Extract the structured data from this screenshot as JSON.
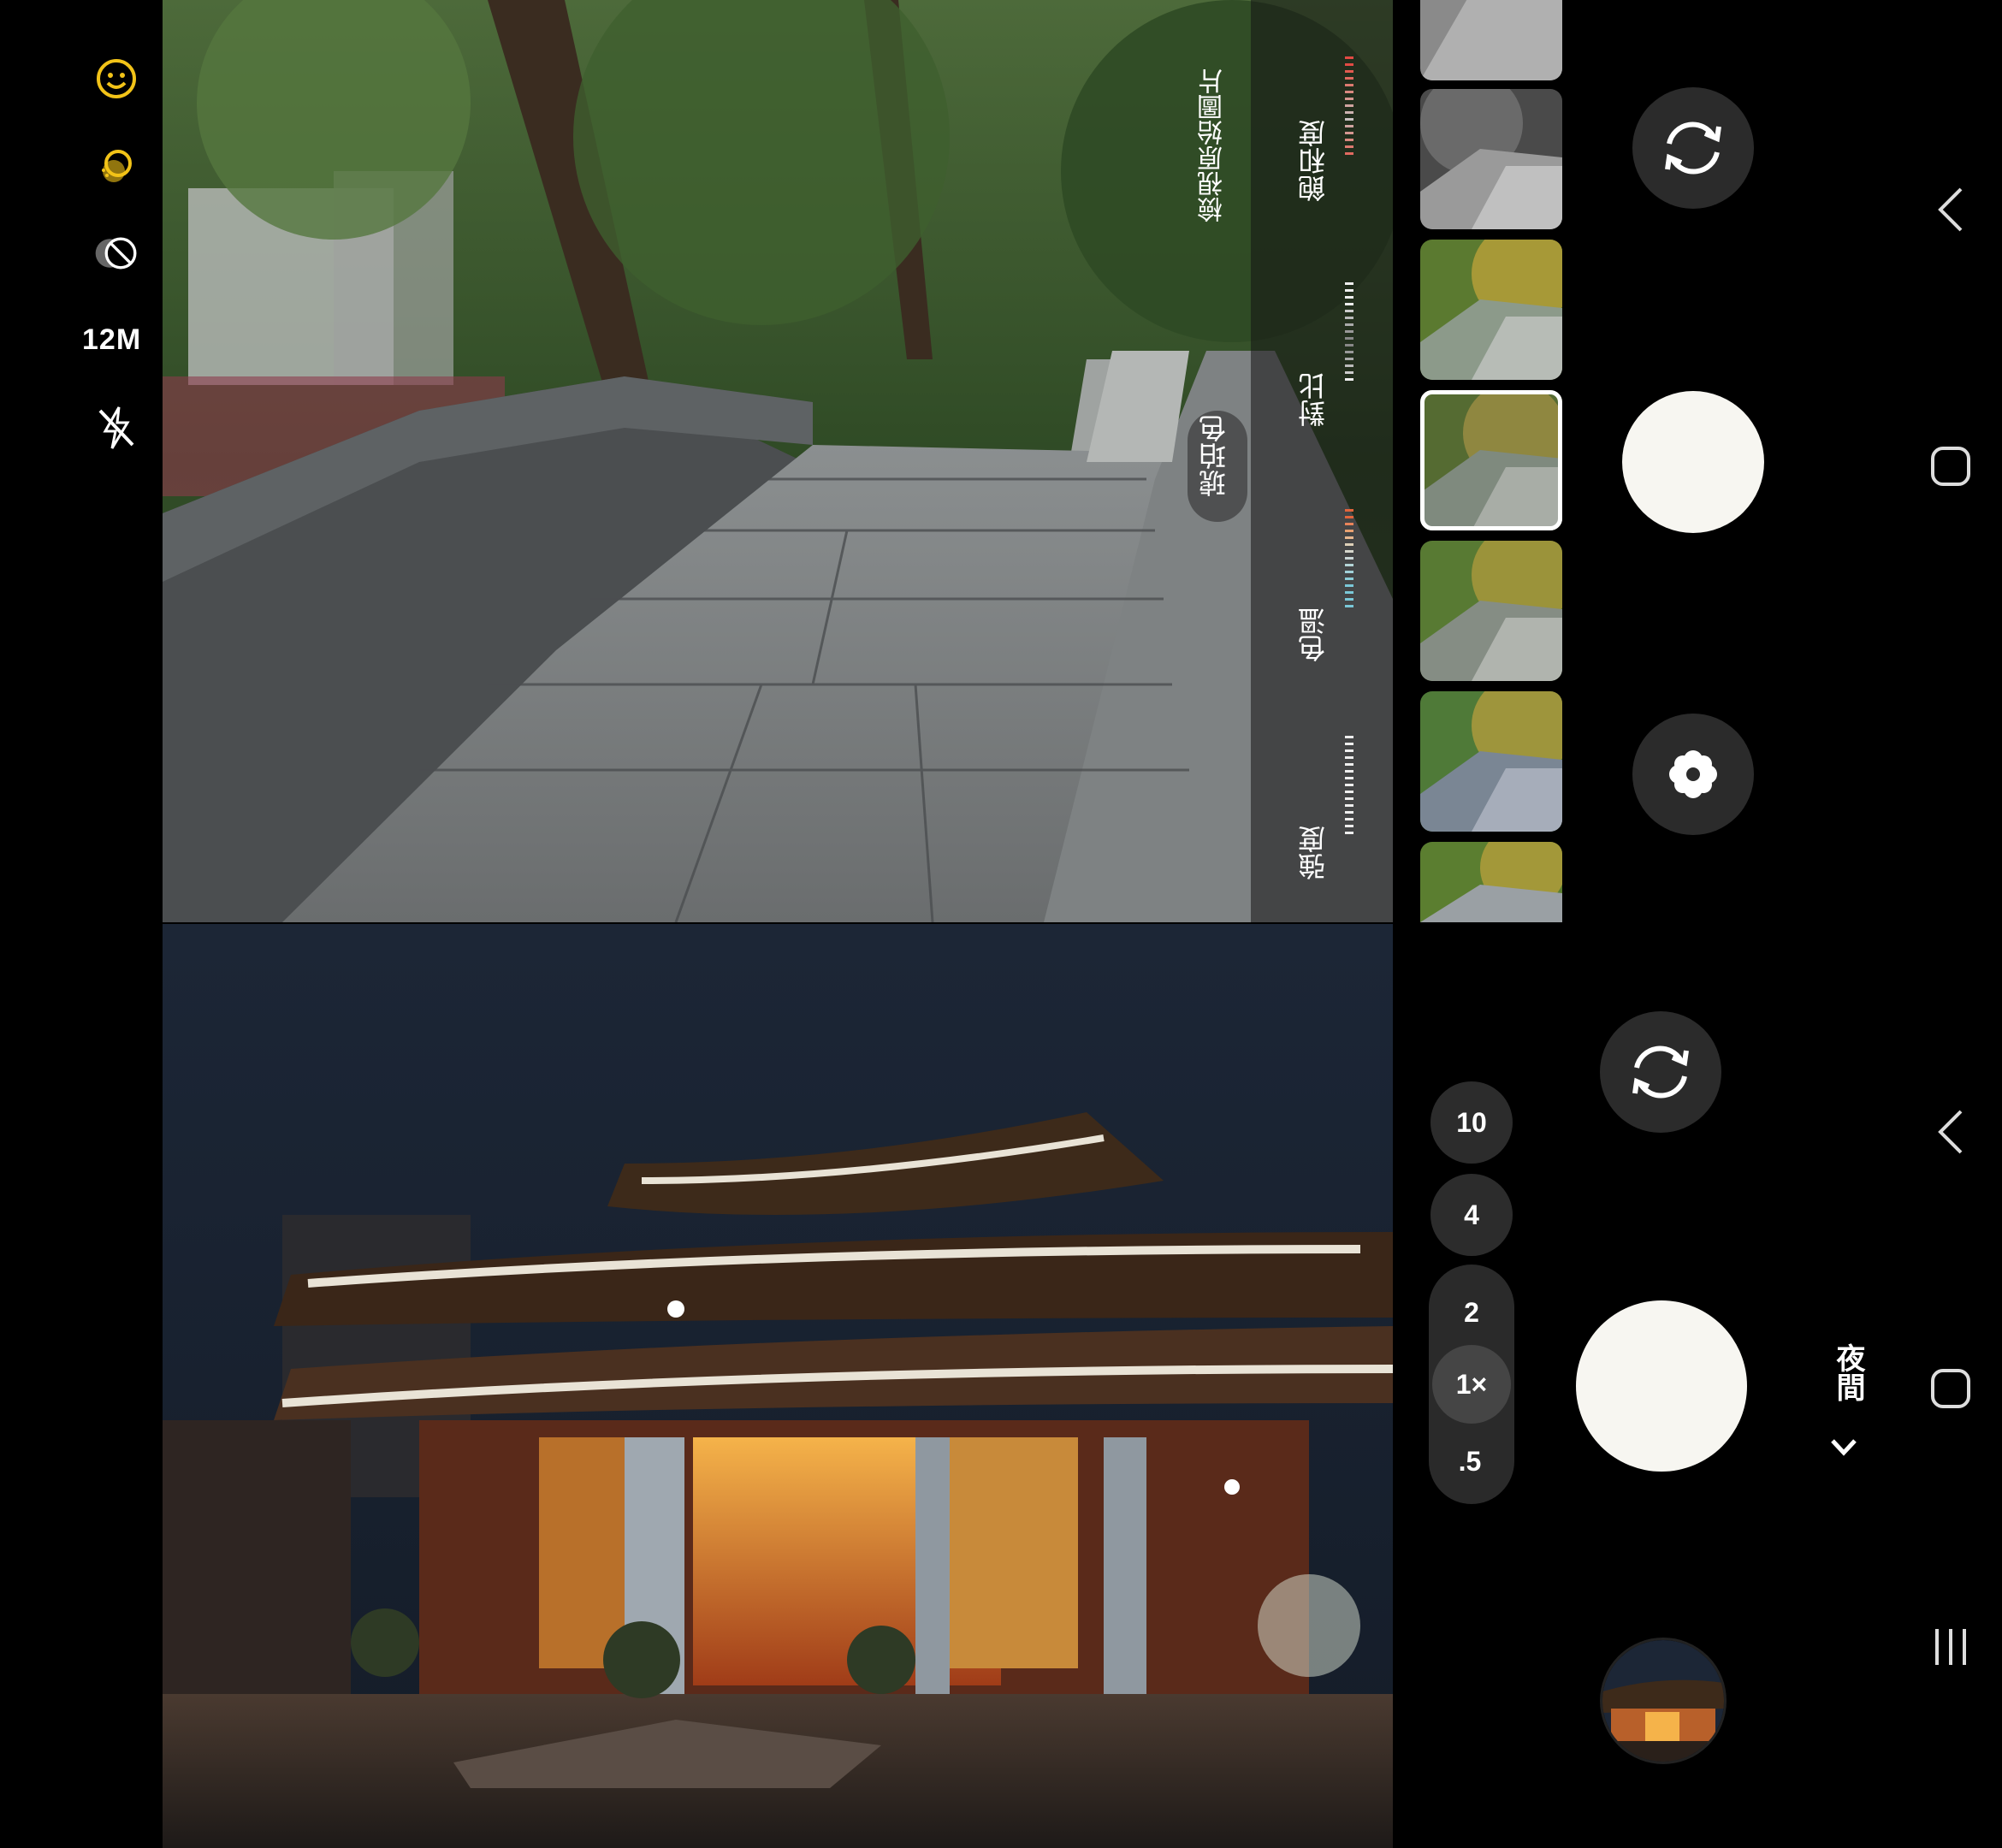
{
  "left_settings": {
    "resolution": "12M",
    "icons": [
      "face-effect-icon",
      "filter-icon",
      "motion-off-icon",
      "flash-off-icon"
    ]
  },
  "filter_panel": {
    "view_original": "檢視原始圖片",
    "filter_name": "琥珀色",
    "sliders": [
      "強度",
      "色溫",
      "對比",
      "飽和度"
    ]
  },
  "zoom": {
    "options": [
      "10",
      "4",
      "2",
      "1×",
      ".5"
    ],
    "active": "1×"
  },
  "mode": {
    "label": "夜間"
  },
  "colors": {
    "accent_yellow": "#f2c318",
    "shutter": "#f7f6f1",
    "button_bg": "#2b2b2b"
  }
}
